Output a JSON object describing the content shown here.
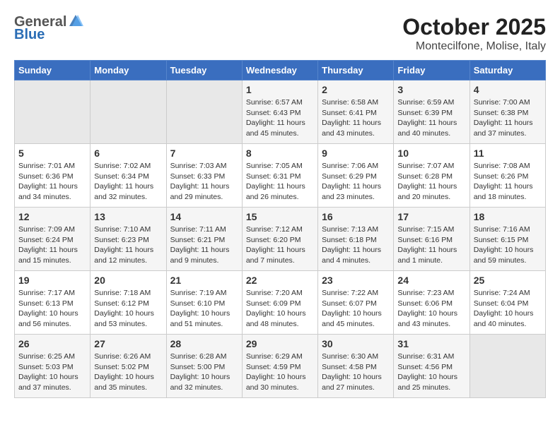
{
  "header": {
    "logo_general": "General",
    "logo_blue": "Blue",
    "month_title": "October 2025",
    "subtitle": "Montecilfone, Molise, Italy"
  },
  "weekdays": [
    "Sunday",
    "Monday",
    "Tuesday",
    "Wednesday",
    "Thursday",
    "Friday",
    "Saturday"
  ],
  "weeks": [
    [
      {
        "day": "",
        "empty": true
      },
      {
        "day": "",
        "empty": true
      },
      {
        "day": "",
        "empty": true
      },
      {
        "day": "1",
        "sunrise": "Sunrise: 6:57 AM",
        "sunset": "Sunset: 6:43 PM",
        "daylight": "Daylight: 11 hours and 45 minutes."
      },
      {
        "day": "2",
        "sunrise": "Sunrise: 6:58 AM",
        "sunset": "Sunset: 6:41 PM",
        "daylight": "Daylight: 11 hours and 43 minutes."
      },
      {
        "day": "3",
        "sunrise": "Sunrise: 6:59 AM",
        "sunset": "Sunset: 6:39 PM",
        "daylight": "Daylight: 11 hours and 40 minutes."
      },
      {
        "day": "4",
        "sunrise": "Sunrise: 7:00 AM",
        "sunset": "Sunset: 6:38 PM",
        "daylight": "Daylight: 11 hours and 37 minutes."
      }
    ],
    [
      {
        "day": "5",
        "sunrise": "Sunrise: 7:01 AM",
        "sunset": "Sunset: 6:36 PM",
        "daylight": "Daylight: 11 hours and 34 minutes."
      },
      {
        "day": "6",
        "sunrise": "Sunrise: 7:02 AM",
        "sunset": "Sunset: 6:34 PM",
        "daylight": "Daylight: 11 hours and 32 minutes."
      },
      {
        "day": "7",
        "sunrise": "Sunrise: 7:03 AM",
        "sunset": "Sunset: 6:33 PM",
        "daylight": "Daylight: 11 hours and 29 minutes."
      },
      {
        "day": "8",
        "sunrise": "Sunrise: 7:05 AM",
        "sunset": "Sunset: 6:31 PM",
        "daylight": "Daylight: 11 hours and 26 minutes."
      },
      {
        "day": "9",
        "sunrise": "Sunrise: 7:06 AM",
        "sunset": "Sunset: 6:29 PM",
        "daylight": "Daylight: 11 hours and 23 minutes."
      },
      {
        "day": "10",
        "sunrise": "Sunrise: 7:07 AM",
        "sunset": "Sunset: 6:28 PM",
        "daylight": "Daylight: 11 hours and 20 minutes."
      },
      {
        "day": "11",
        "sunrise": "Sunrise: 7:08 AM",
        "sunset": "Sunset: 6:26 PM",
        "daylight": "Daylight: 11 hours and 18 minutes."
      }
    ],
    [
      {
        "day": "12",
        "sunrise": "Sunrise: 7:09 AM",
        "sunset": "Sunset: 6:24 PM",
        "daylight": "Daylight: 11 hours and 15 minutes."
      },
      {
        "day": "13",
        "sunrise": "Sunrise: 7:10 AM",
        "sunset": "Sunset: 6:23 PM",
        "daylight": "Daylight: 11 hours and 12 minutes."
      },
      {
        "day": "14",
        "sunrise": "Sunrise: 7:11 AM",
        "sunset": "Sunset: 6:21 PM",
        "daylight": "Daylight: 11 hours and 9 minutes."
      },
      {
        "day": "15",
        "sunrise": "Sunrise: 7:12 AM",
        "sunset": "Sunset: 6:20 PM",
        "daylight": "Daylight: 11 hours and 7 minutes."
      },
      {
        "day": "16",
        "sunrise": "Sunrise: 7:13 AM",
        "sunset": "Sunset: 6:18 PM",
        "daylight": "Daylight: 11 hours and 4 minutes."
      },
      {
        "day": "17",
        "sunrise": "Sunrise: 7:15 AM",
        "sunset": "Sunset: 6:16 PM",
        "daylight": "Daylight: 11 hours and 1 minute."
      },
      {
        "day": "18",
        "sunrise": "Sunrise: 7:16 AM",
        "sunset": "Sunset: 6:15 PM",
        "daylight": "Daylight: 10 hours and 59 minutes."
      }
    ],
    [
      {
        "day": "19",
        "sunrise": "Sunrise: 7:17 AM",
        "sunset": "Sunset: 6:13 PM",
        "daylight": "Daylight: 10 hours and 56 minutes."
      },
      {
        "day": "20",
        "sunrise": "Sunrise: 7:18 AM",
        "sunset": "Sunset: 6:12 PM",
        "daylight": "Daylight: 10 hours and 53 minutes."
      },
      {
        "day": "21",
        "sunrise": "Sunrise: 7:19 AM",
        "sunset": "Sunset: 6:10 PM",
        "daylight": "Daylight: 10 hours and 51 minutes."
      },
      {
        "day": "22",
        "sunrise": "Sunrise: 7:20 AM",
        "sunset": "Sunset: 6:09 PM",
        "daylight": "Daylight: 10 hours and 48 minutes."
      },
      {
        "day": "23",
        "sunrise": "Sunrise: 7:22 AM",
        "sunset": "Sunset: 6:07 PM",
        "daylight": "Daylight: 10 hours and 45 minutes."
      },
      {
        "day": "24",
        "sunrise": "Sunrise: 7:23 AM",
        "sunset": "Sunset: 6:06 PM",
        "daylight": "Daylight: 10 hours and 43 minutes."
      },
      {
        "day": "25",
        "sunrise": "Sunrise: 7:24 AM",
        "sunset": "Sunset: 6:04 PM",
        "daylight": "Daylight: 10 hours and 40 minutes."
      }
    ],
    [
      {
        "day": "26",
        "sunrise": "Sunrise: 6:25 AM",
        "sunset": "Sunset: 5:03 PM",
        "daylight": "Daylight: 10 hours and 37 minutes."
      },
      {
        "day": "27",
        "sunrise": "Sunrise: 6:26 AM",
        "sunset": "Sunset: 5:02 PM",
        "daylight": "Daylight: 10 hours and 35 minutes."
      },
      {
        "day": "28",
        "sunrise": "Sunrise: 6:28 AM",
        "sunset": "Sunset: 5:00 PM",
        "daylight": "Daylight: 10 hours and 32 minutes."
      },
      {
        "day": "29",
        "sunrise": "Sunrise: 6:29 AM",
        "sunset": "Sunset: 4:59 PM",
        "daylight": "Daylight: 10 hours and 30 minutes."
      },
      {
        "day": "30",
        "sunrise": "Sunrise: 6:30 AM",
        "sunset": "Sunset: 4:58 PM",
        "daylight": "Daylight: 10 hours and 27 minutes."
      },
      {
        "day": "31",
        "sunrise": "Sunrise: 6:31 AM",
        "sunset": "Sunset: 4:56 PM",
        "daylight": "Daylight: 10 hours and 25 minutes."
      },
      {
        "day": "",
        "empty": true
      }
    ]
  ]
}
